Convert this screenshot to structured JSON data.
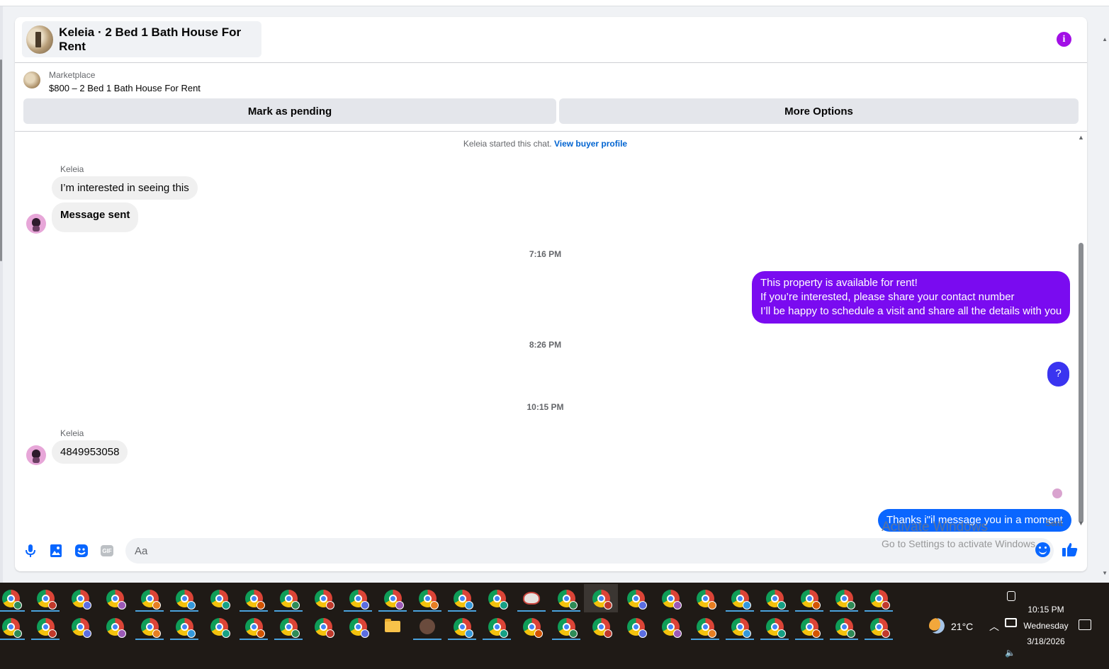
{
  "header": {
    "title": "Keleia · 2 Bed 1 Bath House For Rent",
    "info_icon": "info-icon"
  },
  "listing": {
    "source": "Marketplace",
    "title": "$800 – 2 Bed 1 Bath House For Rent",
    "mark_pending_label": "Mark as pending",
    "more_options_label": "More Options"
  },
  "thread": {
    "started_text": "Keleia started this chat.",
    "view_profile_link": "View buyer profile",
    "messages": [
      {
        "sender": "Keleia",
        "text": "I’m interested in seeing this"
      },
      {
        "text": "Message sent"
      },
      {
        "timestamp": "7:16 PM"
      },
      {
        "lines": [
          "This property is available for rent!",
          "If you’re interested, please share your contact number",
          "I’ll be happy to schedule a visit and share all the details with you"
        ]
      },
      {
        "timestamp": "8:26 PM"
      },
      {
        "text": "?"
      },
      {
        "timestamp": "10:15 PM"
      },
      {
        "sender": "Keleia",
        "text": "4849953058"
      },
      {
        "text": "Thanks i\"il message you in a moment",
        "status": "Sent"
      }
    ],
    "colors": {
      "outgoing_purple": "#7a0bf0",
      "outgoing_indigo": "#3a34f0",
      "outgoing_blue": "#0a66ff",
      "incoming": "#f0f0f0"
    }
  },
  "composer": {
    "placeholder": "Aa",
    "icons": [
      "microphone-icon",
      "photo-icon",
      "sticker-icon",
      "gif-icon",
      "emoji-icon",
      "like-icon"
    ],
    "gif_label": "GIF"
  },
  "watermark": {
    "line1": "Activate Windows",
    "line2": "Go to Settings to activate Windows."
  },
  "taskbar": {
    "weather_temp": "21°C",
    "time": "10:15 PM",
    "day": "Wednesday",
    "date": "3/18/2026"
  }
}
